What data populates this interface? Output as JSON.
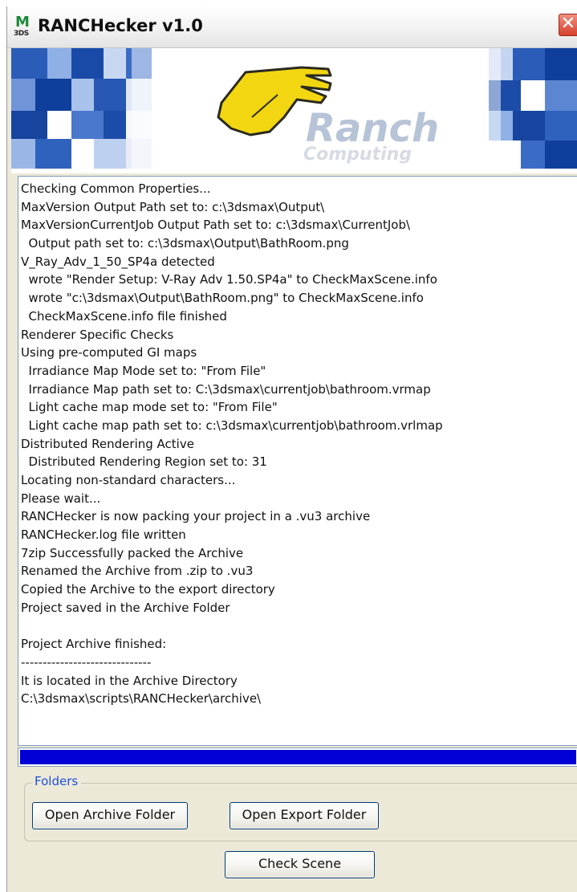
{
  "window": {
    "title": "RANCHecker v1.0",
    "icon_letter": "M",
    "icon_sub": "3DS",
    "close_symbol": "✕"
  },
  "banner": {
    "logo_word": "Ranch",
    "logo_sub": "Computing"
  },
  "log": {
    "lines": [
      "Checking Common Properties...",
      "MaxVersion Output Path set to: c:\\3dsmax\\Output\\",
      "MaxVersionCurrentJob Output Path set to: c:\\3dsmax\\CurrentJob\\",
      "  Output path set to: c:\\3dsmax\\Output\\BathRoom.png",
      "V_Ray_Adv_1_50_SP4a detected",
      "  wrote \"Render Setup: V-Ray Adv 1.50.SP4a\" to CheckMaxScene.info",
      "  wrote \"c:\\3dsmax\\Output\\BathRoom.png\" to CheckMaxScene.info",
      "  CheckMaxScene.info file finished",
      "Renderer Specific Checks",
      "Using pre-computed GI maps",
      "  Irradiance Map Mode set to: \"From File\"",
      "  Irradiance Map path set to: C:\\3dsmax\\currentjob\\bathroom.vrmap",
      "  Light cache map mode set to: \"From File\"",
      "  Light cache map path set to: c:\\3dsmax\\currentjob\\bathroom.vrlmap",
      "Distributed Rendering Active",
      "  Distributed Rendering Region set to: 31",
      "Locating non-standard characters...",
      "Please wait...",
      "RANCHecker is now packing your project in a .vu3 archive",
      "RANCHecker.log file written",
      "7zip Successfully packed the Archive",
      "Renamed the Archive from .zip to .vu3",
      "Copied the Archive to the export directory",
      "Project saved in the Archive Folder",
      "",
      "Project Archive finished:",
      "------------------------------",
      "It is located in the Archive Directory",
      "C:\\3dsmax\\scripts\\RANCHecker\\archive\\"
    ]
  },
  "progress": {
    "percent": 100,
    "color": "#0000d6"
  },
  "folders": {
    "legend": "Folders",
    "open_archive_label": "Open Archive Folder",
    "open_export_label": "Open Export Folder"
  },
  "actions": {
    "check_scene_label": "Check Scene"
  }
}
